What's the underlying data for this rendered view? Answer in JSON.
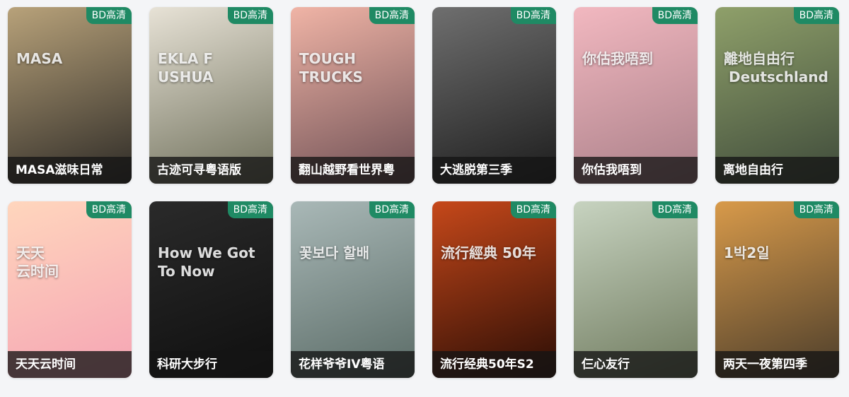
{
  "badge_label": "BD高清",
  "items": [
    {
      "title": "MASA滋味日常",
      "poster_text": "MASA",
      "icon": "poster-masa",
      "bg": [
        "#b8a27a",
        "#2d2a26"
      ]
    },
    {
      "title": "古迹可寻粤语版",
      "poster_text": "EKLA F\nUSHUA",
      "icon": "poster-heritage",
      "bg": [
        "#e7e2d6",
        "#6e6f5a"
      ]
    },
    {
      "title": "翻山越野看世界粤",
      "poster_text": "TOUGH\nTRUCKS",
      "icon": "poster-trucks",
      "bg": [
        "#f0b4a6",
        "#6d4f54"
      ]
    },
    {
      "title": "大逃脱第三季",
      "poster_text": "",
      "icon": "poster-escape",
      "bg": [
        "#6f6f6f",
        "#1c1c1c"
      ]
    },
    {
      "title": "你估我唔到",
      "poster_text": "你估我唔到",
      "icon": "poster-guess",
      "bg": [
        "#f2b8c0",
        "#a97f88"
      ]
    },
    {
      "title": "离地自由行",
      "poster_text": "離地自由行\n Deutschland ",
      "icon": "poster-road-sign",
      "bg": [
        "#8fa06a",
        "#3e4a3a"
      ]
    },
    {
      "title": "天天云时间",
      "poster_text": "天天\n云时间",
      "icon": "poster-cloud-time",
      "bg": [
        "#ffd6bd",
        "#f5a4b4"
      ]
    },
    {
      "title": "科研大步行",
      "poster_text": "How We Got\nTo Now",
      "icon": "poster-how-we-got",
      "bg": [
        "#2a2a2a",
        "#0f0f0f"
      ]
    },
    {
      "title": "花样爷爷IV粤语",
      "poster_text": "꽃보다 할배",
      "icon": "poster-grandpas",
      "bg": [
        "#a9b8b7",
        "#5a6b66"
      ]
    },
    {
      "title": "流行经典50年S2",
      "poster_text": "流行經典 50年",
      "icon": "poster-pop-classics",
      "bg": [
        "#c6481a",
        "#2a0d05"
      ]
    },
    {
      "title": "仨心友行",
      "poster_text": "",
      "icon": "poster-friends",
      "bg": [
        "#c7d3c0",
        "#6f7a5e"
      ]
    },
    {
      "title": "两天一夜第四季",
      "poster_text": "1박2일",
      "icon": "poster-two-days",
      "bg": [
        "#d89a4a",
        "#4b3d2b"
      ]
    }
  ]
}
